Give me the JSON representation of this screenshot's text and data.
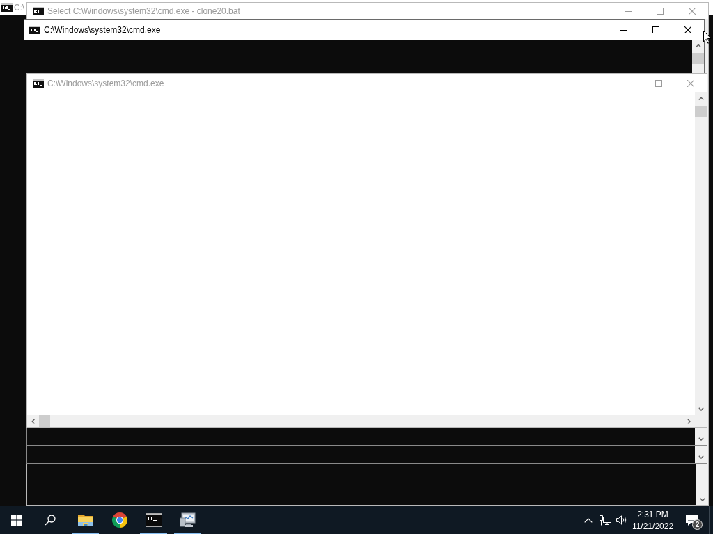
{
  "windows": [
    {
      "title": "C:\\",
      "active": false
    },
    {
      "title": "Select C:\\Windows\\system32\\cmd.exe - clone20.bat",
      "active": false
    },
    {
      "title": "C:\\Windows\\system32\\cmd.exe",
      "active": true
    },
    {
      "title": "C:\\Windows\\system32\\cmd.exe",
      "active": false
    }
  ],
  "taskbar": {
    "pinned_apps": [
      {
        "kind": "folder",
        "running": true
      },
      {
        "kind": "browser",
        "running": false
      },
      {
        "kind": "console",
        "running": true
      },
      {
        "kind": "server",
        "running": true
      }
    ],
    "clock": {
      "time": "2:31 PM",
      "date": "11/21/2022"
    },
    "notifications": {
      "count": "2"
    }
  }
}
